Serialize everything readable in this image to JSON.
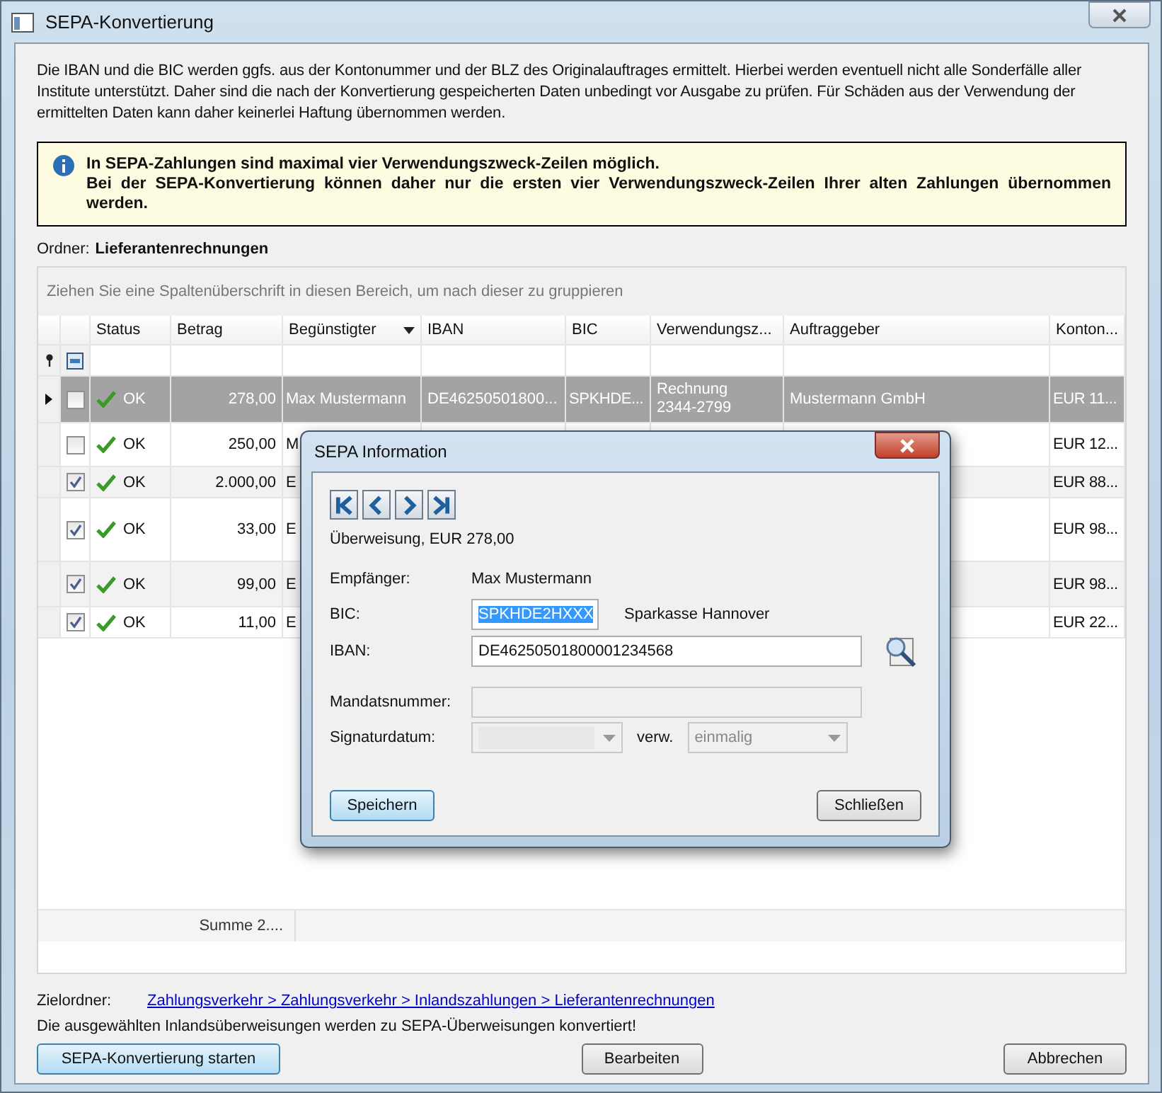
{
  "window": {
    "title": "SEPA-Konvertierung"
  },
  "intro": "Die IBAN und die BIC werden ggfs. aus der Kontonummer und der BLZ des Originalauftrages ermittelt. Hierbei werden eventuell nicht alle Sonderfälle aller Institute unterstützt. Daher sind die nach der Konvertierung gespeicherten Daten unbedingt vor Ausgabe zu prüfen. Für Schäden aus der Verwendung der ermittelten Daten kann daher keinerlei Haftung übernommen werden.",
  "info": [
    "In SEPA-Zahlungen sind maximal vier Verwendungszweck-Zeilen möglich.",
    "Bei der SEPA-Konvertierung können daher nur die ersten vier Verwendungszweck-Zeilen Ihrer alten Zahlungen übernommen werden."
  ],
  "folder": {
    "label": "Ordner:",
    "name": "Lieferantenrechnungen"
  },
  "grid": {
    "group_hint": "Ziehen Sie eine Spaltenüberschrift in diesen Bereich, um nach dieser zu gruppieren",
    "columns": [
      {
        "label": "Status"
      },
      {
        "label": "Betrag"
      },
      {
        "label": "Begünstigter",
        "filter_menu": true
      },
      {
        "label": "IBAN"
      },
      {
        "label": "BIC"
      },
      {
        "label": "Verwendungsz..."
      },
      {
        "label": "Auftraggeber"
      },
      {
        "label": "Konton..."
      }
    ],
    "rows": [
      {
        "selected": true,
        "checked": false,
        "status": "OK",
        "betrag": "278,00",
        "beguenstigter": "Max Mustermann",
        "iban": "DE46250501800...",
        "bic": "SPKHDE...",
        "verwendungszweck": "Rechnung 2344-2799",
        "auftraggeber": "Mustermann GmbH",
        "konto": "EUR 11..."
      },
      {
        "selected": false,
        "checked": false,
        "status": "OK",
        "betrag": "250,00",
        "beguenstigter": "M",
        "konto": "EUR 12..."
      },
      {
        "selected": false,
        "checked": true,
        "status": "OK",
        "betrag": "2.000,00",
        "beguenstigter": "E",
        "konto": "EUR 88..."
      },
      {
        "selected": false,
        "checked": true,
        "status": "OK",
        "betrag": "33,00",
        "beguenstigter": "E",
        "konto": "EUR 98..."
      },
      {
        "selected": false,
        "checked": true,
        "status": "OK",
        "betrag": "99,00",
        "beguenstigter": "E",
        "konto": "EUR 98..."
      },
      {
        "selected": false,
        "checked": true,
        "status": "OK",
        "betrag": "11,00",
        "beguenstigter": "E",
        "konto": "EUR 22..."
      }
    ],
    "select_all_mixed": true,
    "summary": "Summe 2...."
  },
  "target": {
    "label": "Zielordner:",
    "path": "Zahlungsverkehr > Zahlungsverkehr > Inlandszahlungen > Lieferantenrechnungen"
  },
  "message": "Die ausgewählten Inlandsüberweisungen werden zu SEPA-Überweisungen konvertiert!",
  "buttons": [
    {
      "label": "SEPA-Konvertierung starten",
      "default": true
    },
    {
      "label": "Bearbeiten",
      "default": false
    },
    {
      "label": "Abbrechen",
      "default": false
    }
  ],
  "dialog": {
    "title": "SEPA Information",
    "nav": [
      {
        "kind": "first"
      },
      {
        "kind": "prev"
      },
      {
        "kind": "next"
      },
      {
        "kind": "last"
      }
    ],
    "summary": "Überweisung, EUR 278,00",
    "recipient_label": "Empfänger:",
    "recipient": "Max Mustermann",
    "bic_label": "BIC:",
    "bic": "SPKHDE2HXXX",
    "bank": "Sparkasse Hannover",
    "iban_label": "IBAN:",
    "iban": "DE46250501800001234568",
    "mandate_label": "Mandatsnummer:",
    "signature_label": "Signaturdatum:",
    "usage_label": "verw.",
    "usage": "einmalig",
    "buttons": [
      {
        "label": "Speichern",
        "default": true
      },
      {
        "label": "Schließen",
        "default": false
      }
    ]
  }
}
